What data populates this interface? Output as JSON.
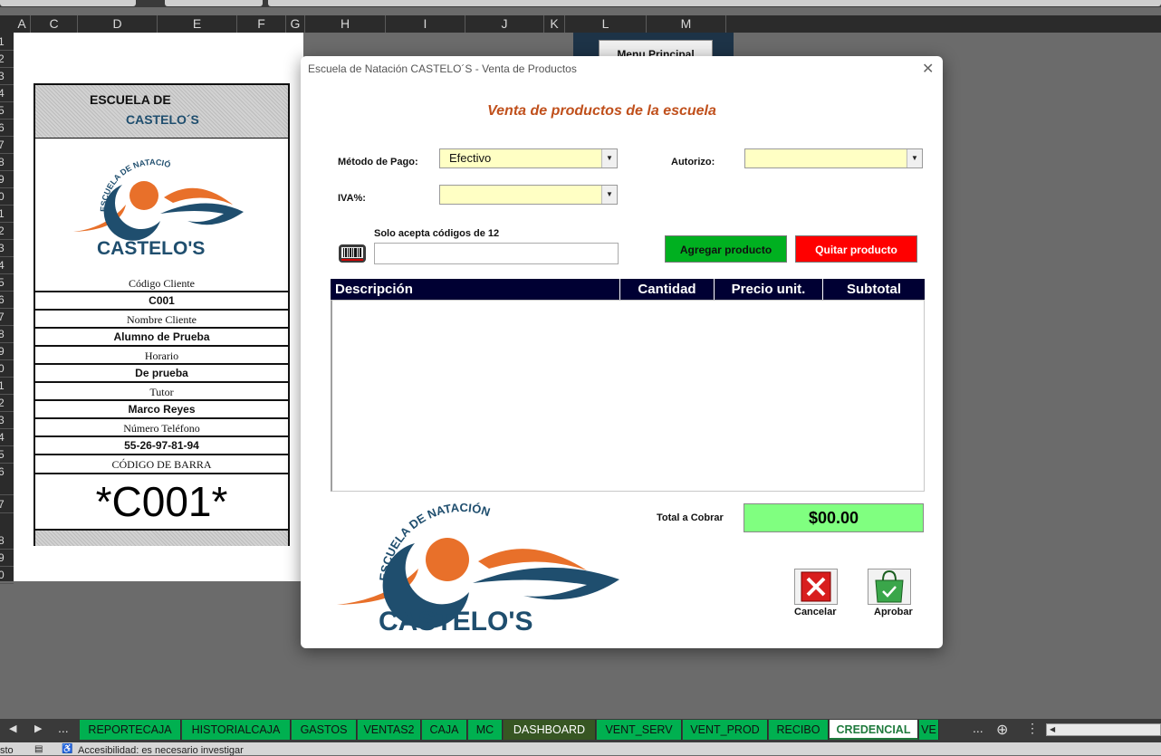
{
  "sheet": {
    "columns": [
      {
        "label": "A",
        "w": 19
      },
      {
        "label": "C",
        "w": 52
      },
      {
        "label": "D",
        "w": 88
      },
      {
        "label": "E",
        "w": 88
      },
      {
        "label": "F",
        "w": 54
      },
      {
        "label": "G",
        "w": 21
      },
      {
        "label": "H",
        "w": 89
      },
      {
        "label": "I",
        "w": 88
      },
      {
        "label": "J",
        "w": 87
      },
      {
        "label": "K",
        "w": 23
      },
      {
        "label": "L",
        "w": 90
      },
      {
        "label": "M",
        "w": 88
      }
    ],
    "rows": [
      "1",
      "2",
      "3",
      "4",
      "5",
      "6",
      "7",
      "8",
      "9",
      "0",
      "1",
      "2",
      "3",
      "4",
      "5",
      "6",
      "7",
      "8",
      "9",
      "0",
      "1",
      "2",
      "3",
      "4",
      "5",
      "6",
      "7",
      "8",
      "9",
      "0"
    ],
    "menu_button": "Menu Principal"
  },
  "card": {
    "header_line1": "ESCUELA DE",
    "header_line2": "CASTELO´S",
    "logo_arc_text": "ESCUELA DE NATACIÓN",
    "logo_name": "CASTELO'S",
    "codigo_label": "Código Cliente",
    "codigo_value": "C001",
    "nombre_label": "Nombre Cliente",
    "nombre_value": "Alumno de Prueba",
    "horario_label": "Horario",
    "horario_value": "De prueba",
    "tutor_label": "Tutor",
    "tutor_value": "Marco Reyes",
    "telefono_label": "Número Teléfono",
    "telefono_value": "55-26-97-81-94",
    "barcode_label": "CÓDIGO DE BARRA",
    "barcode_value": "*C001*"
  },
  "dialog": {
    "title": "Escuela de Natación CASTELO´S - Venta de Productos",
    "heading": "Venta de productos de la escuela",
    "metodo_label": "Método de Pago:",
    "metodo_value": "Efectivo",
    "autorizo_label": "Autorizo:",
    "autorizo_value": "",
    "iva_label": "IVA%:",
    "iva_value": "",
    "code_hint": "Solo acepta códigos de 12",
    "code_value": "",
    "add_button": "Agregar producto",
    "remove_button": "Quitar producto",
    "table_headers": [
      "Descripción",
      "Cantidad",
      "Precio unit.",
      "Subtotal"
    ],
    "total_label": "Total a Cobrar",
    "total_value": "$00.00",
    "cancel_label": "Cancelar",
    "approve_label": "Aprobar",
    "logo_arc_text": "ESCUELA DE NATACIÓN",
    "logo_name": "CASTELO'S"
  },
  "sheet_tabs": [
    "REPORTECAJA",
    "HISTORIALCAJA",
    "GASTOS",
    "VENTAS2",
    "CAJA",
    "MC",
    "DASHBOARD",
    "VENT_SERV",
    "VENT_PROD",
    "RECIBO",
    "CREDENCIAL",
    "VE"
  ],
  "active_tab": "CREDENCIAL",
  "tab_overflow": "...",
  "status": {
    "left": "sto",
    "accessibility": "Accesibilidad: es necesario investigar"
  },
  "colors": {
    "tab_green": "#00b050",
    "dashboard_tab": "#375623",
    "heading_orange": "#c0501c",
    "table_header": "#000033",
    "combo_yellow": "#ffffc4",
    "total_green": "#80ff80",
    "logo_navy": "#1f4e6e",
    "logo_orange": "#e8702a"
  }
}
